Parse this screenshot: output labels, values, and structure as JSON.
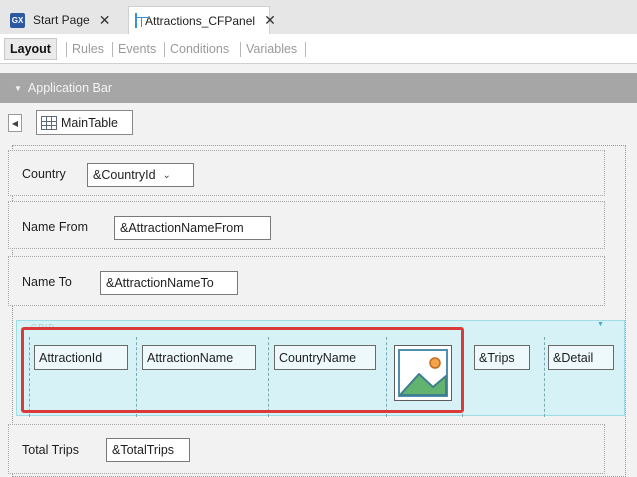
{
  "tabs": [
    {
      "label": "Start Page",
      "icon": "gx-logo-icon"
    },
    {
      "label": "Attractions_CFPanel",
      "icon": "panel-icon",
      "active": true
    }
  ],
  "tab_close": "✕",
  "sub_tabs": [
    "Layout",
    "Rules",
    "Events",
    "Conditions",
    "Variables"
  ],
  "app_bar": {
    "label": "Application Bar",
    "collapse_glyph": "▼"
  },
  "main_table": {
    "label": "MainTable",
    "toggle_glyph": "◀"
  },
  "rows": {
    "country": {
      "label": "Country",
      "value": "&CountryId",
      "dropdown_glyph": "⌄"
    },
    "name_from": {
      "label": "Name From",
      "value": "&AttractionNameFrom"
    },
    "name_to": {
      "label": "Name To",
      "value": "&AttractionNameTo"
    },
    "total_trips": {
      "label": "Total Trips",
      "value": "&TotalTrips"
    }
  },
  "grid": {
    "title": "GRID",
    "menu_glyph": "▼",
    "columns": [
      "AttractionId",
      "AttractionName",
      "CountryName",
      "",
      "&Trips",
      "&Detail"
    ],
    "image_column": "image-icon"
  },
  "colors": {
    "grid_background": "#d7f2f7",
    "highlight": "#d93a3a",
    "app_bar": "#a6a6a6"
  }
}
